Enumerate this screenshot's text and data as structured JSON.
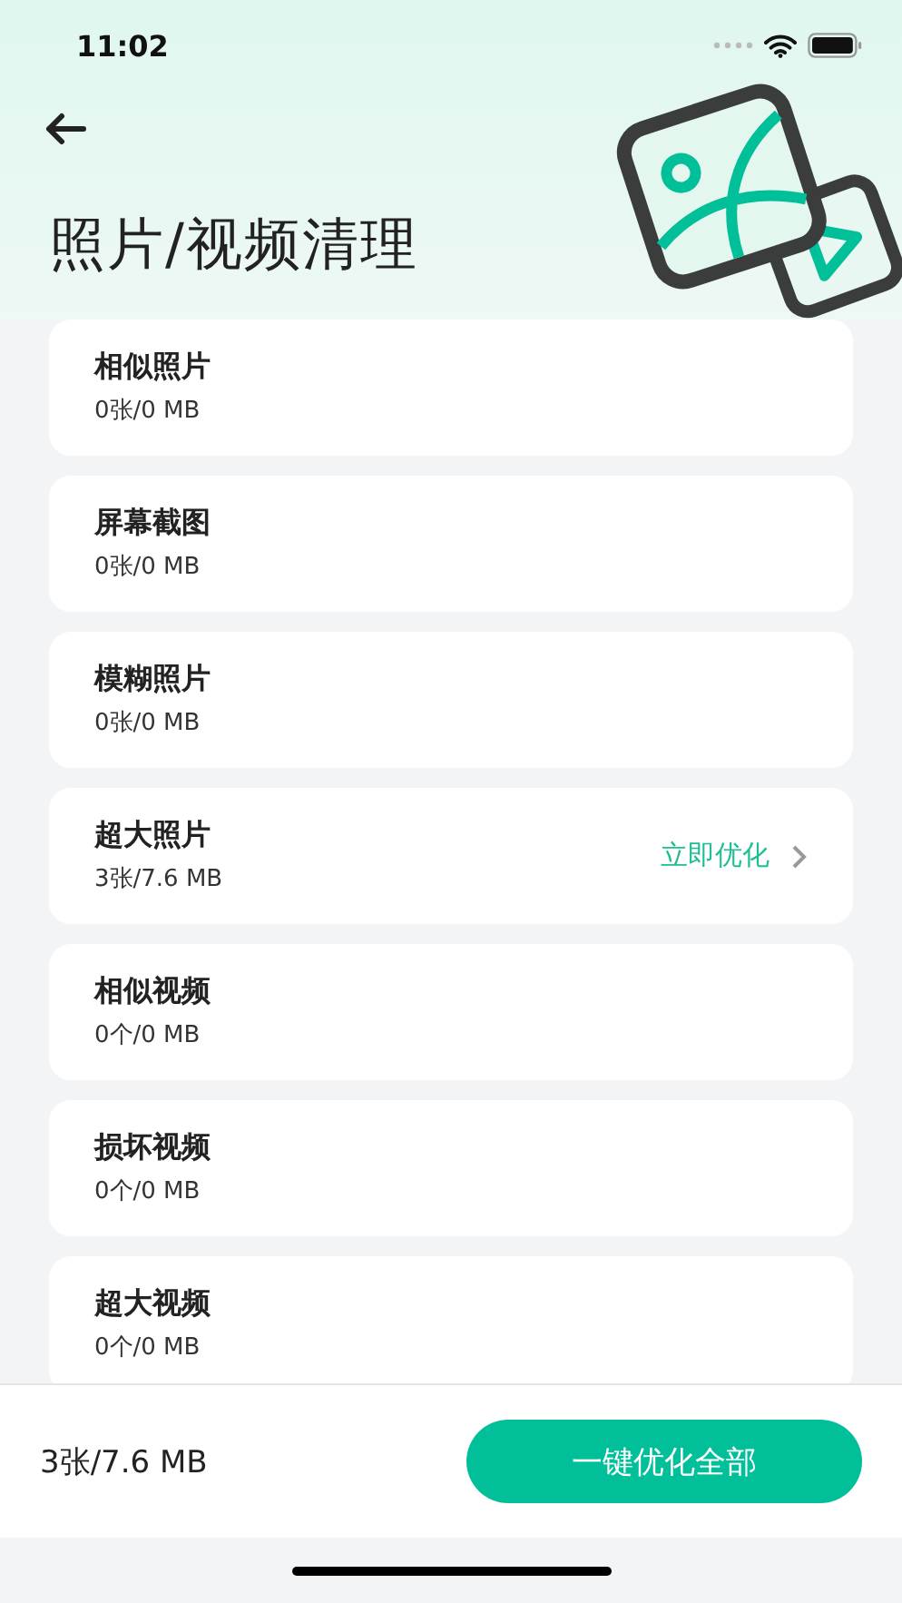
{
  "status_bar": {
    "time": "11:02"
  },
  "title": "照片/视频清理",
  "items": [
    {
      "name": "相似照片",
      "size": "0张/0 MB"
    },
    {
      "name": "屏幕截图",
      "size": "0张/0 MB"
    },
    {
      "name": "模糊照片",
      "size": "0张/0 MB"
    },
    {
      "name": "超大照片",
      "size": "3张/7.6 MB",
      "action": "立即优化"
    },
    {
      "name": "相似视频",
      "size": "0个/0 MB"
    },
    {
      "name": "损坏视频",
      "size": "0个/0 MB"
    },
    {
      "name": "超大视频",
      "size": "0个/0 MB"
    }
  ],
  "footer": {
    "total": "3张/7.6 MB",
    "button": "一键优化全部"
  }
}
